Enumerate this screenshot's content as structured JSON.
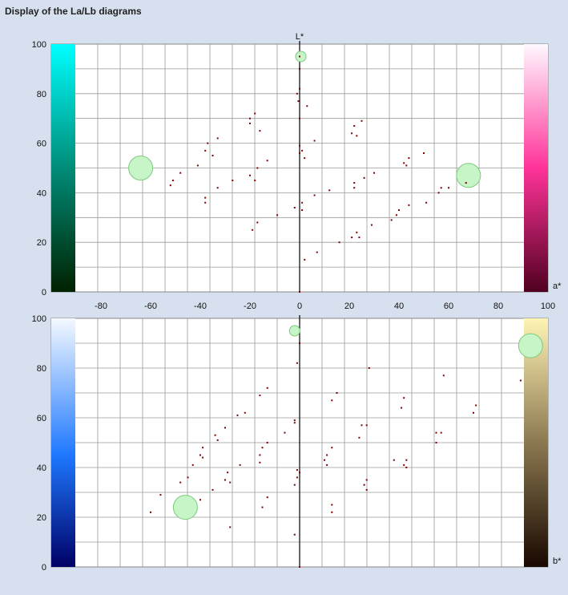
{
  "window": {
    "title": "Display of the La/Lb diagrams"
  },
  "chart_data": [
    {
      "type": "scatter",
      "name_label": "La",
      "xlabel": "a*",
      "ylabel": "L*",
      "xlim": [
        -100,
        100
      ],
      "ylim": [
        0,
        100
      ],
      "yticks": [
        "0",
        "20",
        "40",
        "60",
        "80",
        "100"
      ],
      "xticks": [
        "-80",
        "-60",
        "-40",
        "-20",
        "0",
        "20",
        "40",
        "60",
        "80",
        "100"
      ],
      "grid": true,
      "left_scale_colors": [
        "#00ffff",
        "#008c78",
        "#002200"
      ],
      "right_scale_colors": [
        "#fff8ff",
        "#ff3399",
        "#500020"
      ],
      "point_color": "#800000",
      "highlight_color": "#c8f5c8",
      "highlights": [
        {
          "x": 0.5,
          "y": 95,
          "size": "small"
        },
        {
          "x": -64,
          "y": 50,
          "size": "large"
        },
        {
          "x": 68,
          "y": 47,
          "size": "large"
        }
      ],
      "points": [
        [
          0,
          95
        ],
        [
          0,
          90
        ],
        [
          0,
          82
        ],
        [
          -1,
          80
        ],
        [
          -0.5,
          77
        ],
        [
          3,
          75
        ],
        [
          0,
          70
        ],
        [
          -20,
          70
        ],
        [
          -18,
          72
        ],
        [
          -20,
          68
        ],
        [
          -16,
          65
        ],
        [
          25,
          69
        ],
        [
          22,
          67
        ],
        [
          23,
          63
        ],
        [
          21,
          64
        ],
        [
          -33,
          62
        ],
        [
          -37,
          60
        ],
        [
          -38,
          57
        ],
        [
          -35,
          55
        ],
        [
          -13,
          53
        ],
        [
          -17,
          50
        ],
        [
          -20,
          47
        ],
        [
          -18,
          45
        ],
        [
          0,
          59
        ],
        [
          1,
          57
        ],
        [
          0,
          56
        ],
        [
          2,
          54
        ],
        [
          6,
          61
        ],
        [
          30,
          48
        ],
        [
          50,
          56
        ],
        [
          44,
          54
        ],
        [
          42,
          52
        ],
        [
          43,
          51
        ],
        [
          -41,
          51
        ],
        [
          -48,
          48
        ],
        [
          -51,
          45
        ],
        [
          -52,
          43
        ],
        [
          -27,
          45
        ],
        [
          26,
          46
        ],
        [
          22,
          44
        ],
        [
          22,
          42
        ],
        [
          -33,
          42
        ],
        [
          -38,
          38
        ],
        [
          -38,
          36
        ],
        [
          -2,
          34
        ],
        [
          1,
          33
        ],
        [
          1,
          36
        ],
        [
          6,
          39
        ],
        [
          12,
          41
        ],
        [
          57,
          42
        ],
        [
          60,
          42
        ],
        [
          56,
          40
        ],
        [
          67,
          44
        ],
        [
          44,
          35
        ],
        [
          51,
          36
        ],
        [
          40,
          33
        ],
        [
          39,
          31
        ],
        [
          37,
          29
        ],
        [
          -17,
          28
        ],
        [
          -9,
          31
        ],
        [
          -19,
          25
        ],
        [
          29,
          27
        ],
        [
          23,
          24
        ],
        [
          21,
          22
        ],
        [
          24,
          22
        ],
        [
          16,
          20
        ],
        [
          7,
          16
        ],
        [
          2,
          13
        ],
        [
          0,
          0
        ]
      ]
    },
    {
      "type": "scatter",
      "name_label": "Lb",
      "xlabel": "b*",
      "ylabel": "L*",
      "xlim": [
        -100,
        100
      ],
      "ylim": [
        0,
        100
      ],
      "yticks": [
        "0",
        "20",
        "40",
        "60",
        "80",
        "100"
      ],
      "xticks": [],
      "grid": true,
      "left_scale_colors": [
        "#f4f9ff",
        "#1e78ff",
        "#000066"
      ],
      "right_scale_colors": [
        "#fff4b4",
        "#8c7850",
        "#180800"
      ],
      "point_color": "#800000",
      "highlight_color": "#c8f5c8",
      "highlights": [
        {
          "x": -2,
          "y": 95,
          "size": "small"
        },
        {
          "x": -46,
          "y": 24,
          "size": "large"
        },
        {
          "x": 93,
          "y": 89,
          "size": "large"
        }
      ],
      "points": [
        [
          0,
          90
        ],
        [
          -1,
          82
        ],
        [
          28,
          80
        ],
        [
          58,
          77
        ],
        [
          89,
          75
        ],
        [
          -13,
          72
        ],
        [
          -16,
          69
        ],
        [
          15,
          70
        ],
        [
          13,
          67
        ],
        [
          42,
          68
        ],
        [
          41,
          64
        ],
        [
          71,
          65
        ],
        [
          70,
          62
        ],
        [
          -22,
          62
        ],
        [
          -25,
          61
        ],
        [
          -30,
          56
        ],
        [
          -34,
          53
        ],
        [
          -33,
          51
        ],
        [
          -39,
          48
        ],
        [
          -39,
          44
        ],
        [
          -40,
          45
        ],
        [
          -2,
          59
        ],
        [
          -2,
          58
        ],
        [
          -6,
          54
        ],
        [
          25,
          57
        ],
        [
          27,
          57
        ],
        [
          24,
          52
        ],
        [
          55,
          54
        ],
        [
          57,
          54
        ],
        [
          55,
          50
        ],
        [
          -13,
          50
        ],
        [
          -15,
          48
        ],
        [
          -16,
          45
        ],
        [
          -16,
          42
        ],
        [
          -24,
          41
        ],
        [
          -29,
          38
        ],
        [
          -30,
          35
        ],
        [
          -28,
          34
        ],
        [
          -43,
          41
        ],
        [
          -45,
          36
        ],
        [
          -48,
          34
        ],
        [
          -35,
          31
        ],
        [
          -1,
          36
        ],
        [
          -2,
          33
        ],
        [
          0,
          38
        ],
        [
          -1,
          39
        ],
        [
          11,
          45
        ],
        [
          13,
          48
        ],
        [
          10,
          43
        ],
        [
          11,
          41
        ],
        [
          27,
          35
        ],
        [
          26,
          33
        ],
        [
          27,
          31
        ],
        [
          38,
          43
        ],
        [
          43,
          43
        ],
        [
          42,
          41
        ],
        [
          43,
          40
        ],
        [
          -13,
          28
        ],
        [
          -15,
          24
        ],
        [
          -40,
          27
        ],
        [
          -56,
          29
        ],
        [
          -60,
          22
        ],
        [
          13,
          25
        ],
        [
          13,
          22
        ],
        [
          -28,
          16
        ],
        [
          -2,
          13
        ],
        [
          0,
          0
        ]
      ]
    }
  ]
}
